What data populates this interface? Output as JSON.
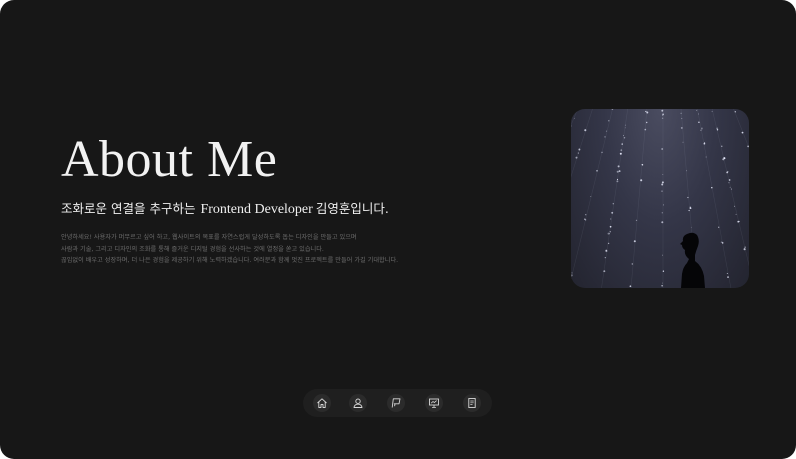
{
  "hero": {
    "title": "About Me",
    "subtitle_prefix": "조화로운 연결을 추구하는",
    "subtitle_role": "Frontend Developer",
    "subtitle_suffix": "김영훈입니다.",
    "description": [
      "안녕하세요! 사용자가 머무르고 싶어 하고, 웹사이트의 목표를 자연스럽게 달성하도록 돕는 디자인을 만들고 있으며",
      "사람과 기술, 그리고 디자인의 조화를 통해 즐거운 디지털 경험을 선사하는 것에 열정을 쏟고 있습니다.",
      "끊임없이 배우고 성장하며, 더 나은 경험을 제공하기 위해 노력하겠습니다. 여러분과 함께 멋진 프로젝트를 만들어 가길 기대합니다."
    ]
  },
  "photo": {
    "subject": "silhouette-under-starlight-strings"
  },
  "dock": {
    "items": [
      {
        "icon": "home-icon",
        "name": "dock-home-button"
      },
      {
        "icon": "person-icon",
        "name": "dock-about-button"
      },
      {
        "icon": "flag-icon",
        "name": "dock-projects-button"
      },
      {
        "icon": "presentation-icon",
        "name": "dock-board-button"
      },
      {
        "icon": "document-icon",
        "name": "dock-contact-button"
      }
    ]
  },
  "colors": {
    "background": "#171717",
    "text": "#f2f2f2",
    "muted_text": "#6c6c6c",
    "dock": "#1f1f1f",
    "dock_button": "#2b2b2b"
  }
}
